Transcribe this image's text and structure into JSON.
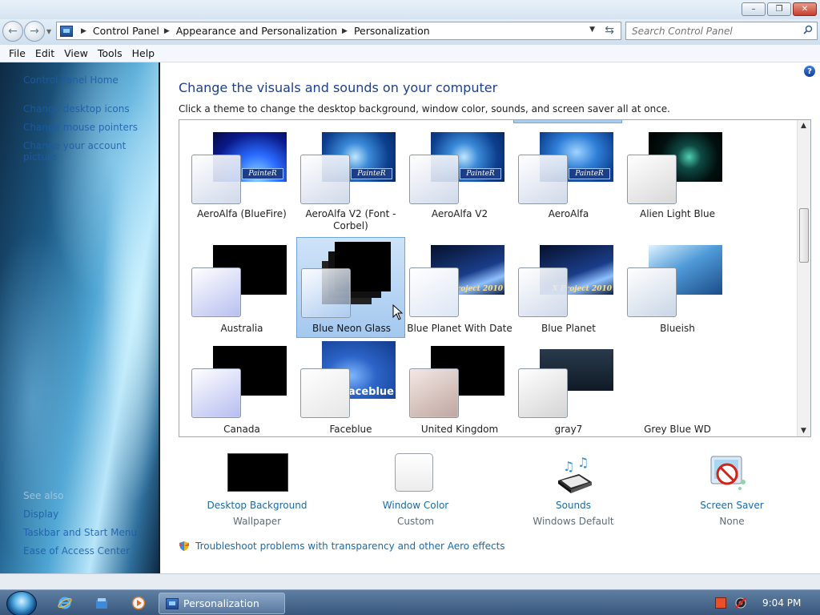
{
  "address": {
    "crumbs": [
      "Control Panel",
      "Appearance and Personalization",
      "Personalization"
    ]
  },
  "search": {
    "placeholder": "Search Control Panel"
  },
  "menu": [
    "File",
    "Edit",
    "View",
    "Tools",
    "Help"
  ],
  "left_pane": {
    "links": [
      "Control Panel Home",
      "Change desktop icons",
      "Change mouse pointers",
      "Change your account picture"
    ],
    "see_also_label": "See also",
    "see_also": [
      "Display",
      "Taskbar and Start Menu",
      "Ease of Access Center"
    ]
  },
  "content": {
    "title": "Change the visuals and sounds on your computer",
    "subtitle": "Click a theme to change the desktop background, window color, sounds, and screen saver all at once.",
    "themes": [
      {
        "name": "AeroAlfa (BlueFire)",
        "selected": false,
        "tag": "PainteR"
      },
      {
        "name": "AeroAlfa V2 (Font - Corbel)",
        "selected": false,
        "tag": "PainteR"
      },
      {
        "name": "AeroAlfa V2",
        "selected": false,
        "tag": "PainteR"
      },
      {
        "name": "AeroAlfa",
        "selected": false,
        "tag": "PainteR"
      },
      {
        "name": "Alien Light Blue",
        "selected": false,
        "tag": ""
      },
      {
        "name": "Australia",
        "selected": false,
        "tag": ""
      },
      {
        "name": "Blue Neon Glass",
        "selected": true,
        "tag": ""
      },
      {
        "name": "Blue Planet With Date",
        "selected": false,
        "tag": "X Project 2010"
      },
      {
        "name": "Blue Planet",
        "selected": false,
        "tag": "X Project 2010"
      },
      {
        "name": "Blueish",
        "selected": false,
        "tag": ""
      },
      {
        "name": "Canada",
        "selected": false,
        "tag": ""
      },
      {
        "name": "Faceblue",
        "selected": false,
        "tag": "faceblue"
      },
      {
        "name": "United Kingdom",
        "selected": false,
        "tag": ""
      },
      {
        "name": "gray7",
        "selected": false,
        "tag": ""
      },
      {
        "name": "Grey Blue WD",
        "selected": false,
        "tag": ""
      }
    ],
    "settings": [
      {
        "label": "Desktop Background",
        "value": "Wallpaper"
      },
      {
        "label": "Window Color",
        "value": "Custom"
      },
      {
        "label": "Sounds",
        "value": "Windows Default"
      },
      {
        "label": "Screen Saver",
        "value": "None"
      }
    ],
    "aero_link": "Troubleshoot problems with transparency and other Aero effects"
  },
  "taskbar": {
    "task_label": "Personalization",
    "clock": "9:04 PM"
  },
  "colors": {
    "link": "#1a6aa8",
    "title": "#1e3f8a",
    "selection": "#a4c8ef"
  }
}
